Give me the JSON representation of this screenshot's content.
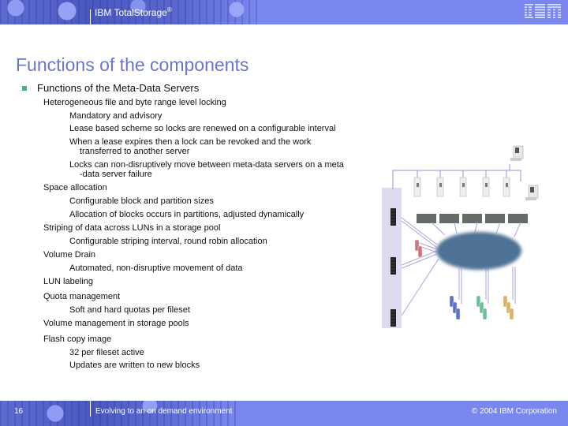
{
  "header": {
    "product": "IBM TotalStorage",
    "registered_mark": "®",
    "logo": "IBM"
  },
  "slide": {
    "title": "Functions of the components",
    "bullet": "Functions of the Meta-Data Servers",
    "lines": [
      {
        "level": 2,
        "text": "Heterogeneous file and byte range level locking"
      },
      {
        "level": 3,
        "text": "Mandatory and advisory"
      },
      {
        "level": 3,
        "text": "Lease based scheme so locks are renewed on a configurable interval"
      },
      {
        "level": 3,
        "text": "When a lease expires then a lock can be revoked and the work"
      },
      {
        "level": 4,
        "text": "transferred to another server"
      },
      {
        "level": 3,
        "text": "Locks can non-disruptively move between meta-data servers on a meta"
      },
      {
        "level": 4,
        "text": "-data server failure"
      },
      {
        "level": 2,
        "text": "Space allocation"
      },
      {
        "level": 3,
        "text": "Configurable block and partition sizes"
      },
      {
        "level": 3,
        "text": "Allocation of blocks occurs in partitions, adjusted dynamically"
      },
      {
        "level": 2,
        "text": "Striping of data across LUNs in a storage pool"
      },
      {
        "level": 3,
        "text": "Configurable striping interval, round robin allocation"
      },
      {
        "level": 2,
        "text": "Volume Drain"
      },
      {
        "level": 3,
        "text": "Automated, non-disruptive movement of data"
      },
      {
        "level": 2,
        "text": "LUN labeling"
      },
      {
        "level": 2,
        "text": "Quota management"
      },
      {
        "level": 3,
        "text": "Soft and hard quotas per fileset"
      },
      {
        "level": 2,
        "text": "Volume management in storage pools"
      },
      {
        "level": 2,
        "text": "Flash copy image"
      },
      {
        "level": 3,
        "text": "32 per fileset active"
      },
      {
        "level": 3,
        "text": "Updates are written to new blocks"
      }
    ]
  },
  "diagram": {
    "description": "SAN File System topology",
    "client_count": 5,
    "admin_console_count": 2,
    "switch_count": 5,
    "metadata_server_count": 3,
    "storage_groups": [
      {
        "name": "red-storage",
        "color": "#c9777a"
      },
      {
        "name": "blue-storage",
        "color": "#5d72c4"
      },
      {
        "name": "green-storage",
        "color": "#6fbf98"
      },
      {
        "name": "orange-storage",
        "color": "#dbb169"
      }
    ],
    "colors": {
      "san_cloud": "#4e7293",
      "switch": "#676b68",
      "network_line": "#a9a6de",
      "server_panel": "#dcdbf0"
    }
  },
  "footer": {
    "page_number": "16",
    "tagline": "Evolving to an on demand environment",
    "copyright": "© 2004 IBM Corporation"
  }
}
